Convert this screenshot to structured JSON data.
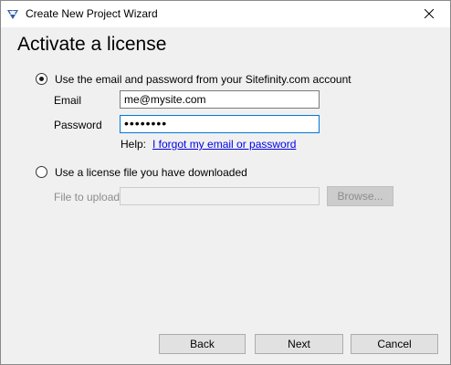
{
  "window": {
    "title": "Create New Project Wizard",
    "app_icon": "sitefinity-logo-icon",
    "close_icon": "close-icon"
  },
  "page": {
    "heading": "Activate a license"
  },
  "account_option": {
    "label": "Use the email and password from your Sitefinity.com account",
    "selected": true,
    "email_label": "Email",
    "email_value": "me@mysite.com",
    "password_label": "Password",
    "password_value": "••••••••",
    "help_label": "Help:",
    "help_link": "I forgot my email or password"
  },
  "file_option": {
    "label": "Use a license file you have downloaded",
    "selected": false,
    "file_label": "File to upload",
    "file_value": "",
    "browse_label": "Browse..."
  },
  "footer": {
    "back_label": "Back",
    "next_label": "Next",
    "cancel_label": "Cancel"
  },
  "colors": {
    "accent": "#0078d7",
    "link": "#0000ee",
    "window_bg": "#f0f0f0",
    "logo": "#2f5aa8"
  }
}
